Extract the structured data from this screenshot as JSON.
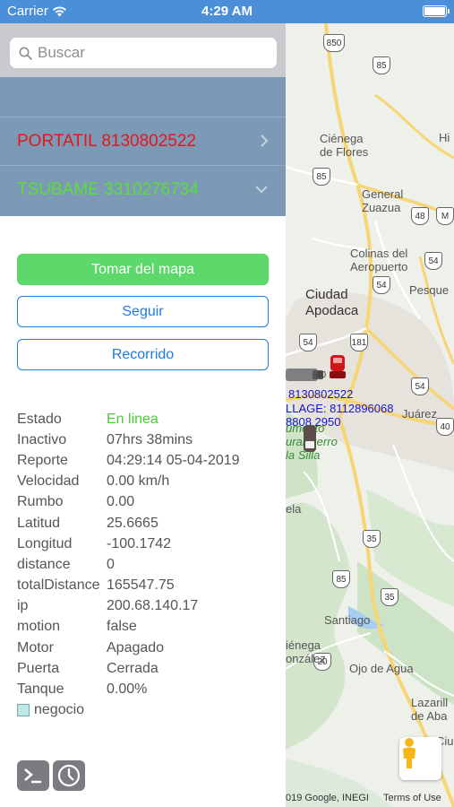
{
  "status_bar": {
    "carrier": "Carrier",
    "time": "4:29 AM"
  },
  "search": {
    "placeholder": "Buscar",
    "value": ""
  },
  "devices": [
    {
      "label": "PORTATIL 8130802522",
      "color": "#e4171d",
      "chevron": "chevron-right"
    },
    {
      "label": "TSUBAME 3310276734",
      "color": "#5bde3a",
      "chevron": "chevron-down"
    }
  ],
  "buttons": {
    "take_from_map": "Tomar del mapa",
    "follow": "Seguir",
    "route": "Recorrido"
  },
  "info": [
    {
      "key": "Estado",
      "value": "En linea"
    },
    {
      "key": "Inactivo",
      "value": "07hrs 38mins"
    },
    {
      "key": "Reporte",
      "value": "04:29:14 05-04-2019"
    },
    {
      "key": "Velocidad",
      "value": "0.00 km/h"
    },
    {
      "key": "Rumbo",
      "value": "0.00"
    },
    {
      "key": "Latitud",
      "value": "25.6665"
    },
    {
      "key": "Longitud",
      "value": "-100.1742"
    },
    {
      "key": "distance",
      "value": "0"
    },
    {
      "key": "totalDistance",
      "value": "165547.75"
    },
    {
      "key": "ip",
      "value": "200.68.140.17"
    },
    {
      "key": "motion",
      "value": "false"
    },
    {
      "key": "Motor",
      "value": "Apagado"
    },
    {
      "key": "Puerta",
      "value": "Cerrada"
    },
    {
      "key": "Tanque",
      "value": "0.00%"
    }
  ],
  "legend": {
    "label": "negocio",
    "color": "#bfe6e6"
  },
  "tools": [
    "terminal-icon",
    "clock-icon"
  ],
  "map": {
    "places": {
      "cienega": "Ciénega\nde Flores",
      "general_zuazua": "General\nZuazua",
      "colinas": "Colinas del\nAeropuerto",
      "pesque": "Pesque",
      "hi": "Hi",
      "ciudad_apodaca": "Ciudad\nApodaca",
      "juarez": "Juárez",
      "cerro_silla": "umento\nural Cerro\nla Silla",
      "ela": "ela",
      "santiago": "Santiago",
      "cienega_gonzalez": "iénega\nonzález",
      "ojo_de_agua": "Ojo de Agua",
      "lazarillo": "Lazarill\nde Aba",
      "ciud": "Ciud"
    },
    "markers": {
      "label1": "8130802522",
      "label2": "LLAGE: 8112896068",
      "label3": "8808 2950",
      "truck_label": "40"
    },
    "road_shields": [
      "850",
      "85",
      "85",
      "48",
      "M",
      "54",
      "54",
      "54",
      "181",
      "54",
      "40",
      "35",
      "85",
      "35",
      "20"
    ],
    "attribution": "019 Google, INEGI",
    "terms": "Terms of Use"
  }
}
